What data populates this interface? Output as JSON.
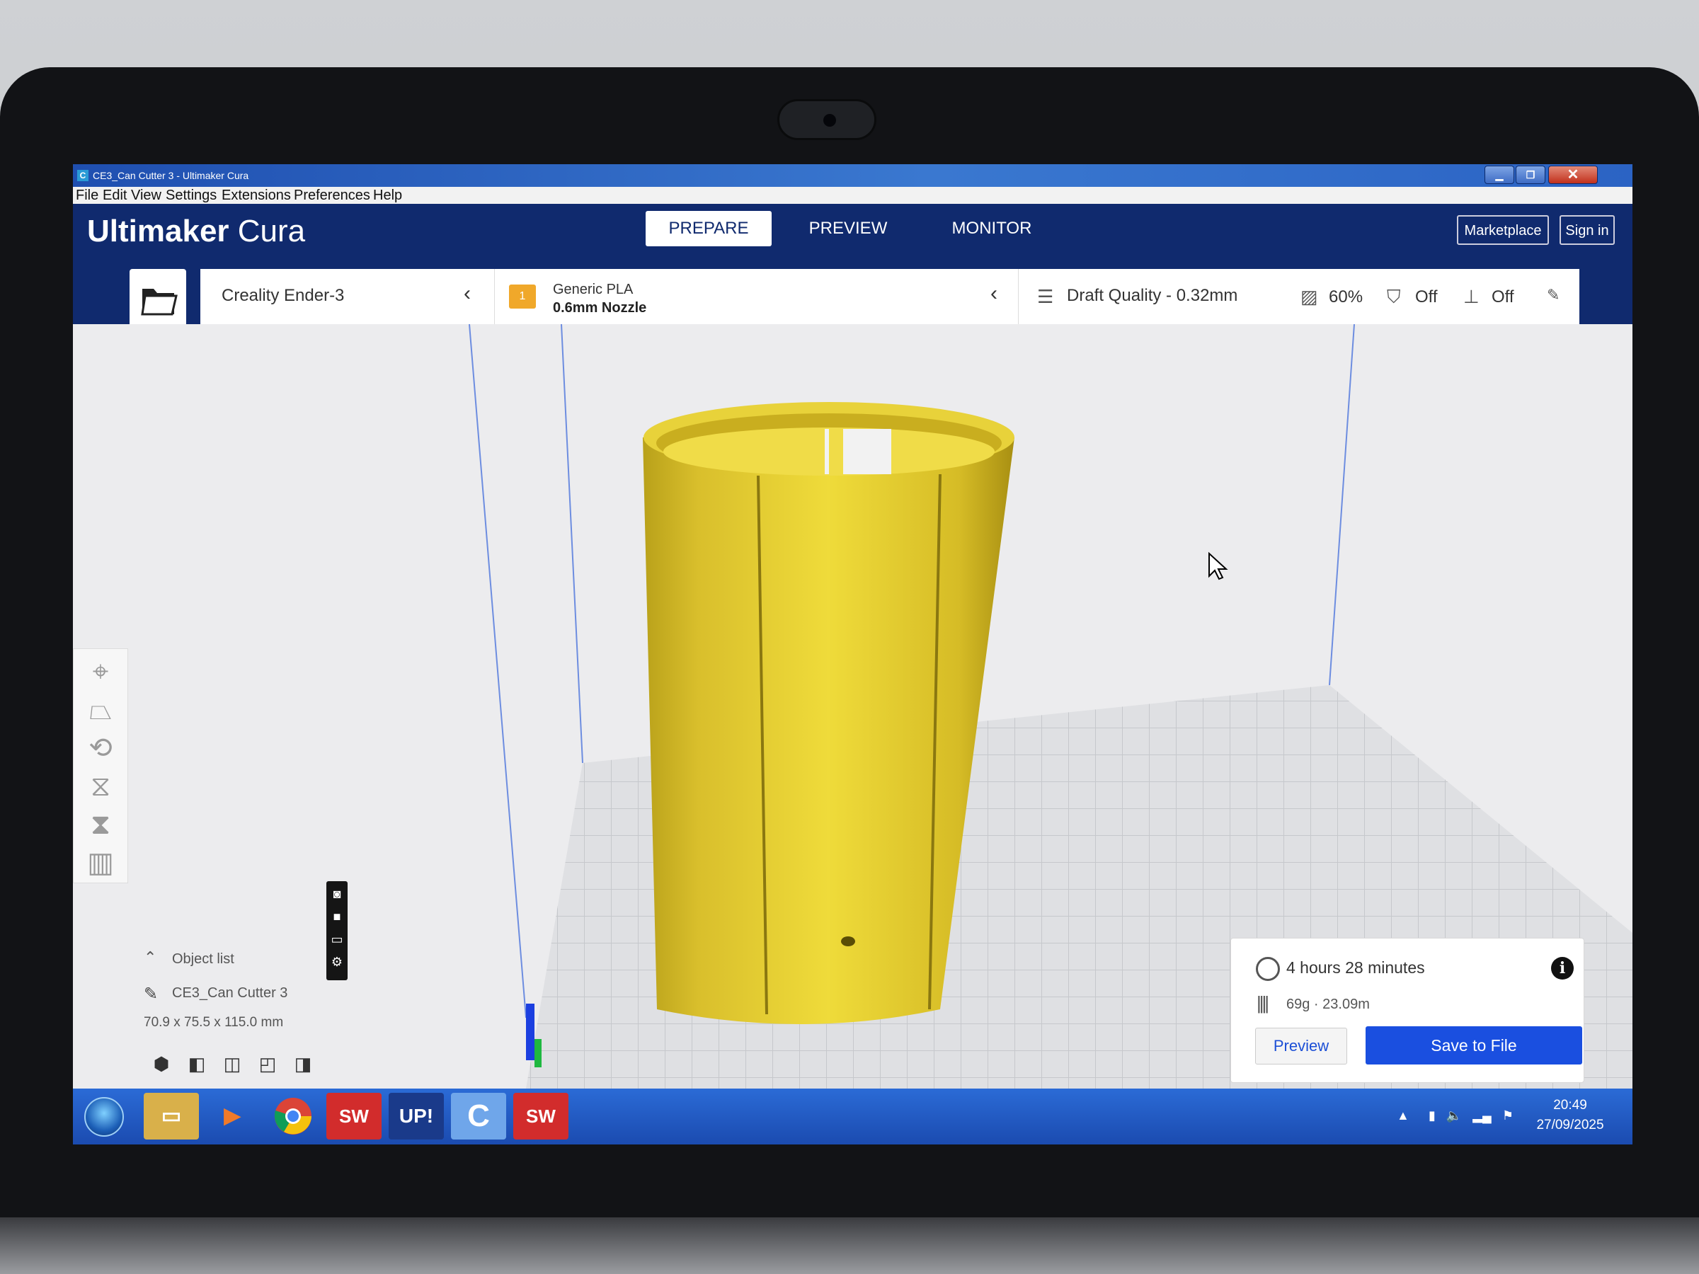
{
  "window": {
    "title": "CE3_Can Cutter 3 - Ultimaker Cura",
    "app_icon": "C"
  },
  "menu": [
    "File",
    "Edit",
    "View",
    "Settings",
    "Extensions",
    "Preferences",
    "Help"
  ],
  "header": {
    "logo_primary": "Ultimaker",
    "logo_secondary": "Cura",
    "tabs": [
      {
        "label": "PREPARE",
        "active": true
      },
      {
        "label": "PREVIEW",
        "active": false
      },
      {
        "label": "MONITOR",
        "active": false
      }
    ],
    "marketplace_label": "Marketplace",
    "signin_label": "Sign in"
  },
  "printer": {
    "name": "Creality Ender-3"
  },
  "material": {
    "badge": "1",
    "name": "Generic PLA",
    "nozzle": "0.6mm Nozzle"
  },
  "print_settings": {
    "quality": "Draft Quality - 0.32mm",
    "infill": "60%",
    "support": "Off",
    "adhesion": "Off"
  },
  "object_list": {
    "title": "Object list",
    "object_name": "CE3_Can Cutter 3",
    "dimensions": "70.9 x 75.5 x 115.0 mm"
  },
  "estimate": {
    "time": "4 hours 28 minutes",
    "material": "69g · 23.09m",
    "preview_label": "Preview",
    "save_label": "Save to File"
  },
  "taskbar": {
    "apps": [
      "explorer",
      "media-player",
      "chrome",
      "solidworks",
      "up-studio",
      "cura",
      "solidworks"
    ],
    "up_label": "UP!",
    "cura_label": "C",
    "sw_label": "SW",
    "time": "20:49",
    "date": "27/09/2025"
  },
  "colors": {
    "cura_blue": "#102a6e",
    "accent_blue": "#1a4fe0",
    "model_yellow": "#e8d23a",
    "material_badge": "#f0a82a"
  }
}
